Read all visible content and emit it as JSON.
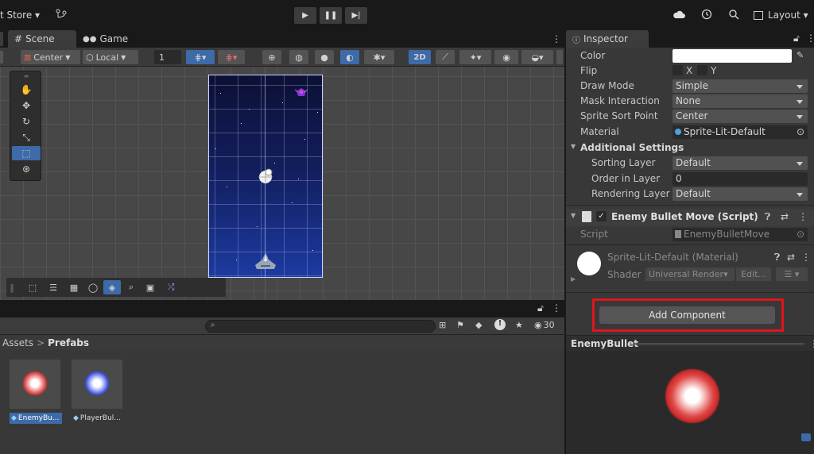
{
  "topbar": {
    "store_label": "t Store ▾",
    "layout_label": "Layout ▾"
  },
  "tabs": {
    "scene": "Scene",
    "game": "Game",
    "inspector": "Inspector"
  },
  "scene_toolbar": {
    "pivot": "Center",
    "space": "Local",
    "grid_size": "1",
    "mode_2d": "2D"
  },
  "project": {
    "search_placeholder": "",
    "hidden_count": "30",
    "breadcrumb_root": "Assets",
    "breadcrumb_sep": ">",
    "breadcrumb_current": "Prefabs",
    "assets": [
      {
        "name": "EnemyBu...",
        "color": "#d33838"
      },
      {
        "name": "PlayerBul...",
        "color": "#3a50e0"
      }
    ]
  },
  "inspector": {
    "color_label": "Color",
    "flip_label": "Flip",
    "flip_x": "X",
    "flip_y": "Y",
    "draw_mode_label": "Draw Mode",
    "draw_mode_value": "Simple",
    "mask_label": "Mask Interaction",
    "mask_value": "None",
    "sort_point_label": "Sprite Sort Point",
    "sort_point_value": "Center",
    "material_label": "Material",
    "material_value": "Sprite-Lit-Default",
    "additional_settings": "Additional Settings",
    "sorting_layer_label": "Sorting Layer",
    "sorting_layer_value": "Default",
    "order_label": "Order in Layer",
    "order_value": "0",
    "rendering_layer_label": "Rendering Layer M",
    "rendering_layer_value": "Default",
    "component_title": "Enemy Bullet Move (Script)",
    "script_label": "Script",
    "script_value": "EnemyBulletMove",
    "material_title": "Sprite-Lit-Default (Material)",
    "shader_label": "Shader",
    "shader_value": "Universal Render▾",
    "edit_label": "Edit...",
    "add_component": "Add Component",
    "preview_title": "EnemyBullet"
  },
  "colors": {
    "highlight": "#e0141e",
    "accent": "#3d6aa8",
    "enemy_bullet": "#d33838",
    "player_bullet": "#3a50e0"
  }
}
